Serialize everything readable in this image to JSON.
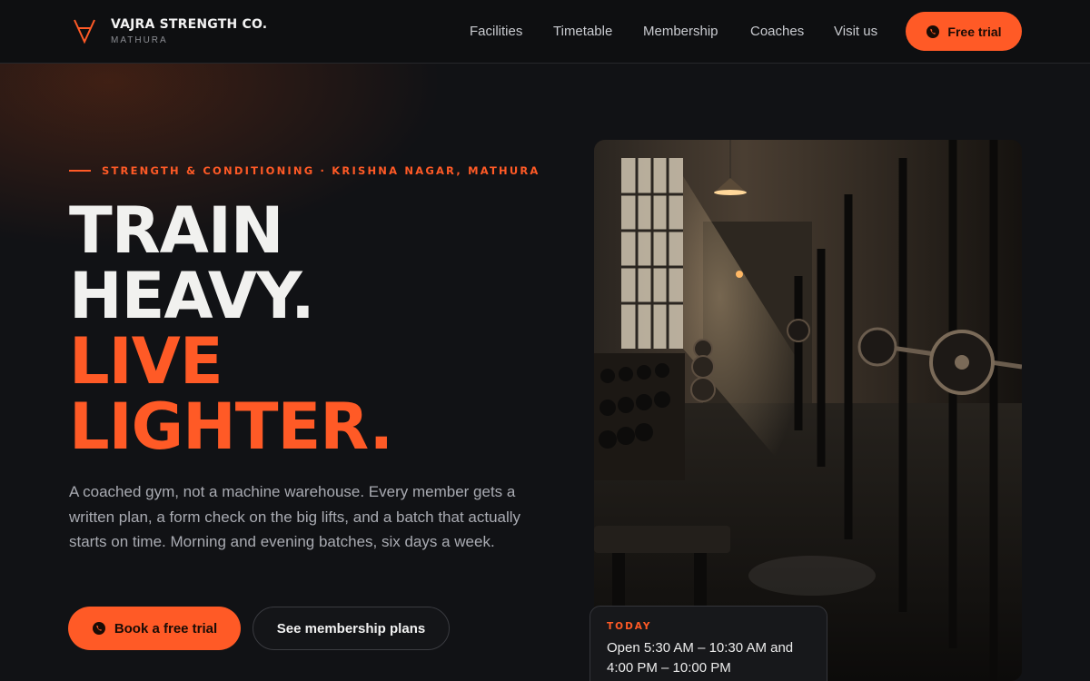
{
  "header": {
    "brand_name": "VAJRA STRENGTH CO.",
    "brand_city": "MATHURA",
    "nav": [
      "Facilities",
      "Timetable",
      "Membership",
      "Coaches",
      "Visit us"
    ],
    "cta": "Free trial"
  },
  "hero": {
    "eyebrow": "STRENGTH & CONDITIONING · KRISHNA NAGAR, MATHURA",
    "headline": [
      "TRAIN",
      "HEAVY.",
      "LIVE",
      "LIGHTER."
    ],
    "lead": "A coached gym, not a machine warehouse. Every member gets a written plan, a form check on the big lifts, and a batch that actually starts on time. Morning and evening batches, six days a week.",
    "primary_button": "Book a free trial",
    "secondary_button": "See membership plans"
  },
  "hours_card": {
    "label": "TODAY",
    "text": "Open 5:30 AM – 10:30 AM and 4:00 PM – 10:00 PM"
  },
  "colors": {
    "accent": "#ff5a26",
    "background": "#111215",
    "header_bg": "#0e0f11"
  },
  "icons": {
    "logo": "vajra-logo-icon",
    "whatsapp": "whatsapp-icon"
  }
}
